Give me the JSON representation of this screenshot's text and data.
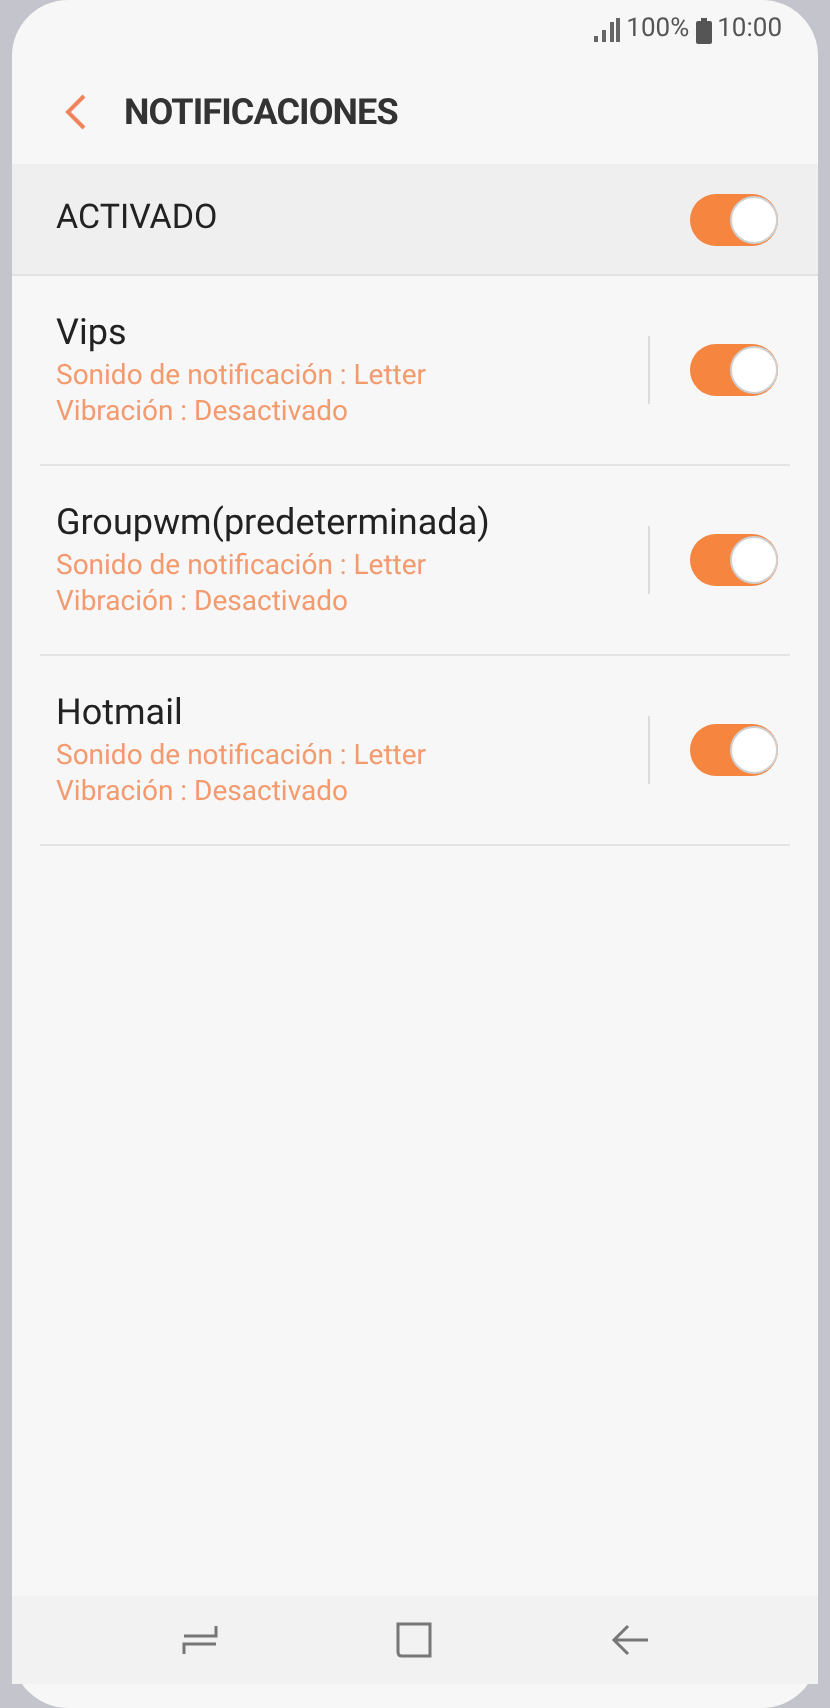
{
  "status_bar": {
    "battery": "100%",
    "time": "10:00"
  },
  "header": {
    "title": "NOTIFICACIONES"
  },
  "master": {
    "label": "ACTIVADO",
    "on": true
  },
  "accounts": [
    {
      "name": "Vips",
      "sound": "Sonido de notificación : Letter",
      "vibration": "Vibración : Desactivado",
      "on": true
    },
    {
      "name": "Groupwm(predeterminada)",
      "sound": "Sonido de notificación : Letter",
      "vibration": "Vibración : Desactivado",
      "on": true
    },
    {
      "name": "Hotmail",
      "sound": "Sonido de notificación : Letter",
      "vibration": "Vibración : Desactivado",
      "on": true
    }
  ]
}
